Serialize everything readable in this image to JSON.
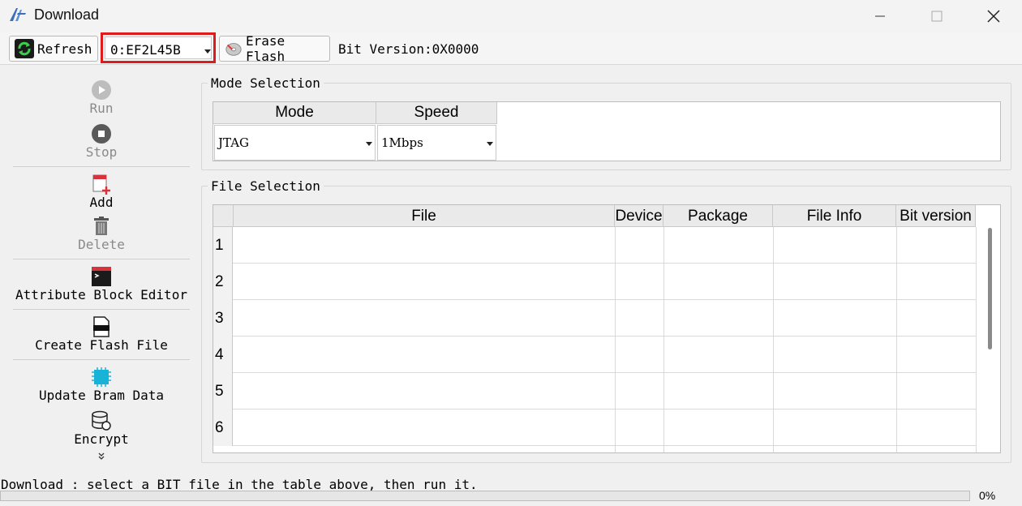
{
  "window": {
    "title": "Download"
  },
  "toolbar": {
    "refresh_label": "Refresh",
    "device_selected": "0:EF2L45B",
    "erase_label": "Erase Flash",
    "bit_version": "Bit Version:0X0000"
  },
  "sidebar": {
    "run": "Run",
    "stop": "Stop",
    "add": "Add",
    "delete": "Delete",
    "attribute": "Attribute Block Editor",
    "create_flash": "Create Flash File",
    "update_bram": "Update Bram Data",
    "encrypt": "Encrypt"
  },
  "mode_selection": {
    "title": "Mode Selection",
    "headers": {
      "mode": "Mode",
      "speed": "Speed"
    },
    "mode_value": "JTAG",
    "speed_value": "1Mbps"
  },
  "file_selection": {
    "title": "File Selection",
    "headers": [
      "File",
      "Device",
      "Package",
      "File Info",
      "Bit version"
    ],
    "rows": [
      "1",
      "2",
      "3",
      "4",
      "5",
      "6"
    ]
  },
  "status": {
    "message": "Download : select a BIT file in the table above, then run it.",
    "progress_percent": 0,
    "progress_label": "0%"
  },
  "colors": {
    "highlight": "#e01b1b",
    "progress": "#06b025"
  },
  "icons": {
    "app": "anlogic-logo-icon",
    "refresh": "refresh-icon",
    "erase": "erase-disk-icon",
    "run": "play-icon",
    "stop": "stop-icon",
    "add": "add-file-icon",
    "delete": "trash-icon",
    "attribute": "terminal-icon",
    "create_flash": "flash-file-icon",
    "update_bram": "ram-chip-icon",
    "encrypt": "database-lock-icon",
    "more": "double-chevron-down-icon"
  }
}
